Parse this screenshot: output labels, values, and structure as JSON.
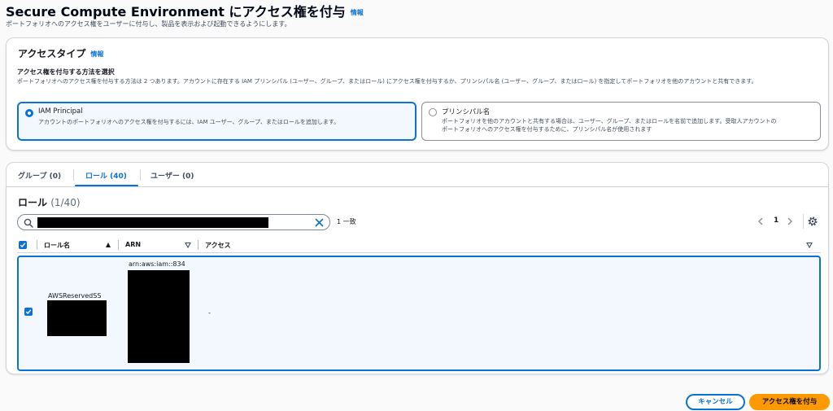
{
  "header": {
    "title": "Secure Compute Environment にアクセス権を付与",
    "info": "情報",
    "description": "ポートフォリオへのアクセス権をユーザーに付与し、製品を表示および起動できるようにします。"
  },
  "access_type": {
    "title": "アクセスタイプ",
    "info": "情報",
    "field_label": "アクセス権を付与する方法を選択",
    "field_desc": "ポートフォリオへのアクセス権を付与する方法は 2 つあります。アカウントに存在する IAM プリンシパル (ユーザー、グループ、またはロール) にアクセス権を付与するか、プリンシパル名 (ユーザー、グループ、またはロール) を指定してポートフォリオを他のアカウントと共有できます。",
    "options": [
      {
        "title": "IAM Principal",
        "desc": "アカウントのポートフォリオへのアクセス権を付与するには、IAM ユーザー、グループ、またはロールを追加します。",
        "selected": true
      },
      {
        "title": "プリンシパル名",
        "desc_line1": "ポートフォリオを他のアカウントと共有する場合は、ユーザー、グループ、またはロールを名前で追加します。受取人アカウントの",
        "desc_line2": "ポートフォリオへのアクセス権を付与するために、プリンシパル名が使用されます",
        "selected": false
      }
    ]
  },
  "tabs": [
    {
      "label": "グループ (0)",
      "active": false
    },
    {
      "label": "ロール (40)",
      "active": true
    },
    {
      "label": "ユーザー (0)",
      "active": false
    }
  ],
  "table": {
    "title": "ロール",
    "count": "(1/40)",
    "match_count": "1 一致",
    "page": "1",
    "columns": [
      "ロール名",
      "ARN",
      "アクセス"
    ],
    "rows": [
      {
        "name": "AWSReservedSS",
        "arn": "arn:aws:iam::834",
        "access": "-",
        "selected": true
      }
    ]
  },
  "footer": {
    "cancel": "キャンセル",
    "submit": "アクセス権を付与"
  },
  "colors": {
    "accent": "#0972d3",
    "primary_button": "#ff9900"
  }
}
